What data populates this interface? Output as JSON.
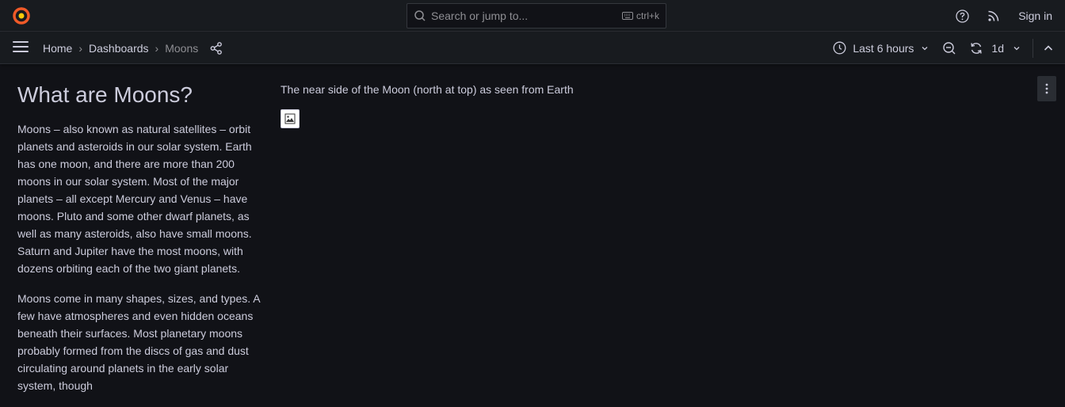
{
  "brand": {
    "logo_icon": "grafana-logo-icon",
    "accent": "#f05a28"
  },
  "search": {
    "placeholder": "Search or jump to...",
    "shortcut": "ctrl+k"
  },
  "topbar": {
    "help_icon": "help-icon",
    "rss_icon": "rss-icon",
    "signin_label": "Sign in"
  },
  "breadcrumb": {
    "items": [
      {
        "label": "Home"
      },
      {
        "label": "Dashboards"
      }
    ],
    "current": "Moons",
    "separator": "›"
  },
  "controls": {
    "time_range": "Last 6 hours",
    "refresh_interval": "1d"
  },
  "text_panel": {
    "title": "What are Moons?",
    "paragraphs": [
      "Moons – also known as natural satellites – orbit planets and asteroids in our solar system. Earth has one moon, and there are more than 200 moons in our solar system. Most of the major planets – all except Mercury and Venus – have moons. Pluto and some other dwarf planets, as well as many asteroids, also have small moons. Saturn and Jupiter have the most moons, with dozens orbiting each of the two giant planets.",
      "Moons come in many shapes, sizes, and types. A few have atmospheres and even hidden oceans beneath their surfaces. Most planetary moons probably formed from the discs of gas and dust circulating around planets in the early solar system, though"
    ]
  },
  "image_panel": {
    "caption": "The near side of the Moon (north at top) as seen from Earth"
  }
}
